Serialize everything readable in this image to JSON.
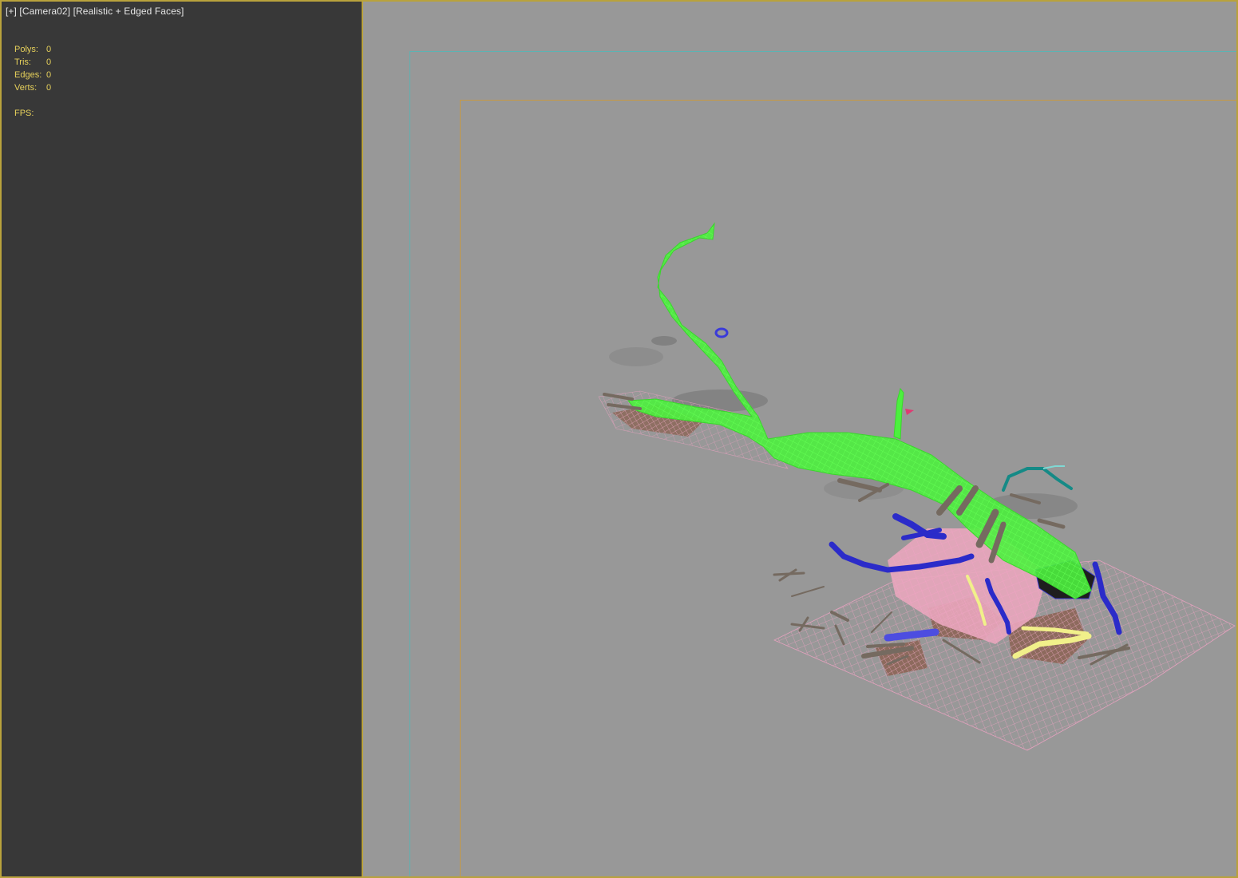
{
  "viewport": {
    "label": {
      "menu": "[+]",
      "camera": "[Camera02]",
      "shading": "[Realistic + Edged Faces]"
    },
    "stats": {
      "polys_label": "Polys:",
      "polys_value": "0",
      "tris_label": "Tris:",
      "tris_value": "0",
      "edges_label": "Edges:",
      "edges_value": "0",
      "verts_label": "Verts:",
      "verts_value": "0",
      "fps_label": "FPS:",
      "fps_value": ""
    }
  },
  "colors": {
    "viewport_border": "#b9a23c",
    "safe_frame": "#5cb3b3",
    "render_frame": "#c69a46",
    "stats_text": "#e7d15b",
    "tree_wire": "#5aff4a",
    "ground_wire": "#f0a3c4",
    "root_wire": "#2c2cd0",
    "stone_wire": "#f1f08a",
    "branch_dark": "#158a86"
  }
}
